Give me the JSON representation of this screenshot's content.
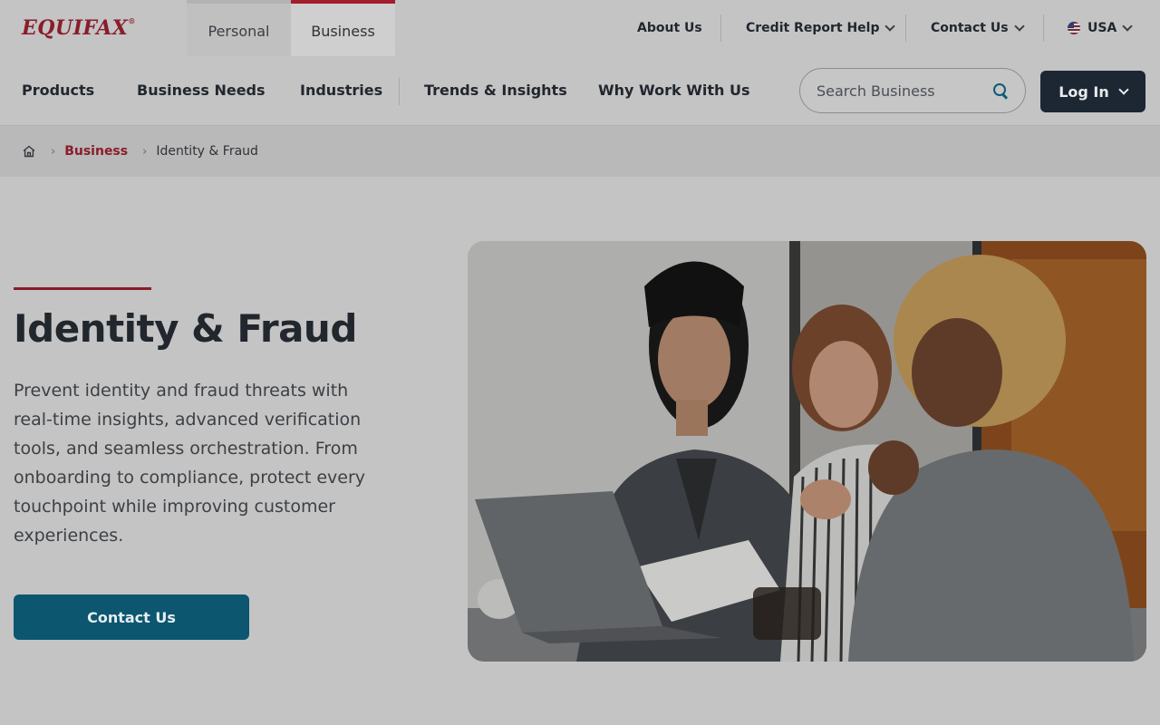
{
  "brand": {
    "name": "EQUIFAX",
    "mark": "®"
  },
  "segments": [
    {
      "label": "Personal",
      "active": false
    },
    {
      "label": "Business",
      "active": true
    }
  ],
  "utility_nav": {
    "about": "About Us",
    "credit_help": "Credit Report Help",
    "contact": "Contact Us",
    "country": "USA"
  },
  "main_nav": {
    "items": [
      "Products",
      "Business Needs",
      "Industries",
      "Trends & Insights",
      "Why Work With Us"
    ]
  },
  "search": {
    "placeholder": "Search Business"
  },
  "login": {
    "label": "Log In"
  },
  "breadcrumb": {
    "parent": "Business",
    "current": "Identity & Fraud"
  },
  "hero": {
    "title": "Identity & Fraud",
    "description": "Prevent identity and fraud threats with real-time insights, advanced verification tools, and seamless orchestration. From onboarding to compliance, protect every touchpoint while improving customer experiences.",
    "cta": "Contact Us"
  },
  "icons": [
    "home-icon",
    "search-icon",
    "chevron-down-icon",
    "us-flag-icon"
  ],
  "colors": {
    "brand_red": "#8a1d2b",
    "cta_teal": "#0d5670",
    "login_navy": "#1c2733"
  }
}
